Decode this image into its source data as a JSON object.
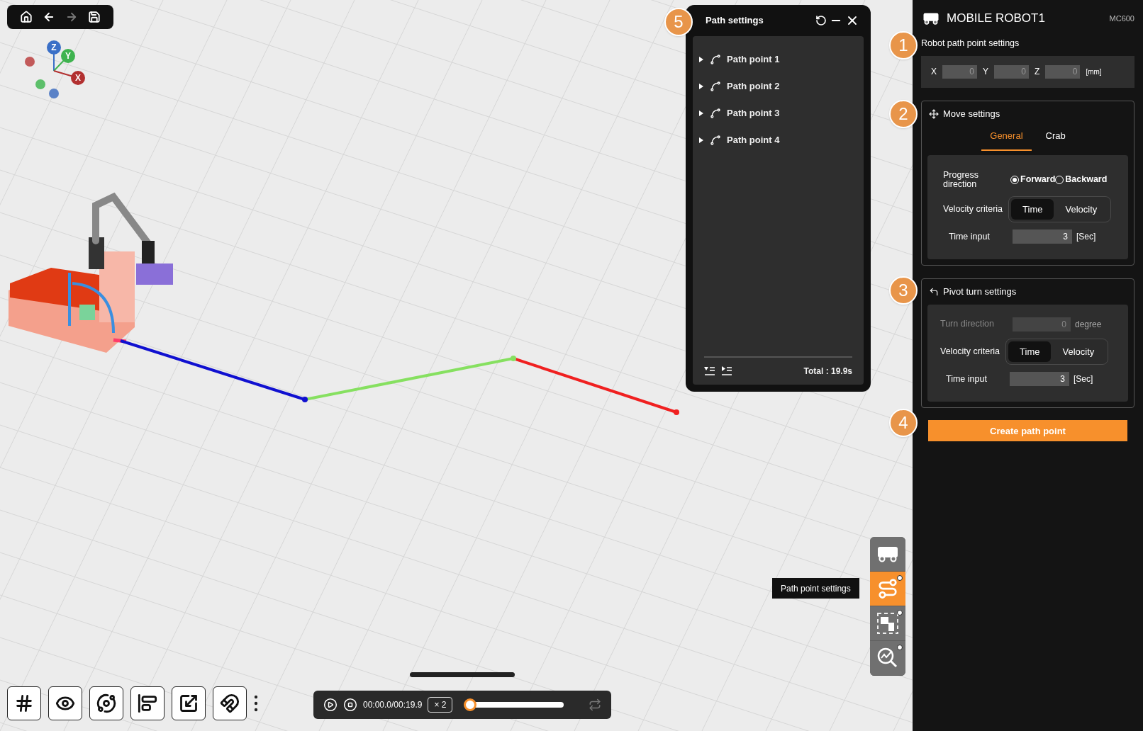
{
  "top_toolbar": {
    "buttons": [
      {
        "kind": "home",
        "disabled": false
      },
      {
        "kind": "back",
        "disabled": false
      },
      {
        "kind": "forward",
        "disabled": true
      },
      {
        "kind": "save",
        "disabled": false
      }
    ]
  },
  "axis_gizmo": {
    "labels": [
      "Z",
      "Y",
      "X"
    ]
  },
  "path_panel": {
    "title": "Path settings",
    "items": [
      {
        "label": "Path point 1",
        "expanded": false
      },
      {
        "label": "Path point 2",
        "expanded": false
      },
      {
        "label": "Path point 3",
        "expanded": false
      },
      {
        "label": "Path point 4",
        "expanded": false
      }
    ],
    "total": "Total : 19.9s"
  },
  "callouts": [
    "1",
    "2",
    "3",
    "4",
    "5"
  ],
  "robot_panel": {
    "title": "MOBILE ROBOT1",
    "model": "MC600",
    "path_point": {
      "heading": "Robot path point settings",
      "fields": [
        {
          "label": "X",
          "value": "0"
        },
        {
          "label": "Y",
          "value": "0"
        },
        {
          "label": "Z",
          "value": "0"
        }
      ],
      "unit": "[mm]"
    },
    "move": {
      "heading": "Move settings",
      "tabs": [
        {
          "label": "General",
          "selected": true
        },
        {
          "label": "Crab",
          "selected": false
        }
      ],
      "direction_label": "Progress direction",
      "directions": [
        {
          "label": "Forward",
          "selected": true
        },
        {
          "label": "Backward",
          "selected": false
        }
      ],
      "velocity_label": "Velocity criteria",
      "velocity_options": [
        {
          "label": "Time",
          "selected": true
        },
        {
          "label": "Velocity",
          "selected": false
        }
      ],
      "time_label": "Time input",
      "time_value": "3",
      "time_unit": "[Sec]"
    },
    "pivot": {
      "heading": "Pivot turn settings",
      "turn_label": "Turn direction",
      "turn_value": "0",
      "turn_unit": "degree",
      "turn_disabled": true,
      "velocity_label": "Velocity criteria",
      "velocity_options": [
        {
          "label": "Time",
          "selected": true
        },
        {
          "label": "Velocity",
          "selected": false
        }
      ],
      "time_label": "Time input",
      "time_value": "3",
      "time_unit": "[Sec]"
    },
    "create_button": "Create path point"
  },
  "dock": {
    "items": [
      {
        "kind": "vehicle",
        "selected": false,
        "badge": false
      },
      {
        "kind": "path",
        "selected": true,
        "badge": true
      },
      {
        "kind": "transform",
        "selected": false,
        "badge": true
      },
      {
        "kind": "analysis",
        "selected": false,
        "badge": true
      }
    ],
    "tooltip": "Path point settings"
  },
  "bottom_toolbar": {
    "tools": [
      {
        "kind": "grid"
      },
      {
        "kind": "eye"
      },
      {
        "kind": "orbit"
      },
      {
        "kind": "align"
      },
      {
        "kind": "scale"
      },
      {
        "kind": "magnet"
      }
    ]
  },
  "playback": {
    "time": "00:00.0/00:19.9",
    "speed": "× 2",
    "level": 0,
    "loop": false
  }
}
